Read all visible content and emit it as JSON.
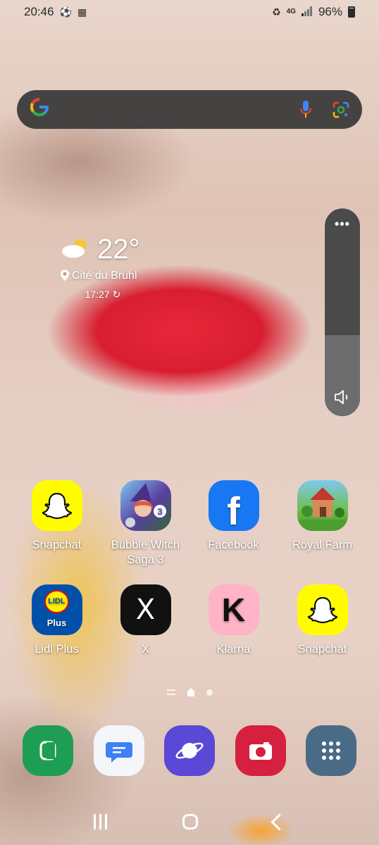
{
  "status_bar": {
    "time": "20:46",
    "network": "4G",
    "battery": "96%"
  },
  "search": {
    "logo": "G"
  },
  "weather": {
    "temperature": "22°",
    "location": "Cité du Bruhl",
    "updated": "17:27"
  },
  "volume": {
    "more_label": "•••",
    "level": 0.47
  },
  "apps": [
    {
      "label": "Snapchat",
      "icon": "snapchat-icon"
    },
    {
      "label": "Bubble Witch Saga 3",
      "icon": "bubble-witch-icon"
    },
    {
      "label": "Facebook",
      "icon": "facebook-icon"
    },
    {
      "label": "Royal Farm",
      "icon": "royal-farm-icon"
    },
    {
      "label": "Lidl Plus",
      "icon": "lidl-plus-icon"
    },
    {
      "label": "X",
      "icon": "x-icon"
    },
    {
      "label": "Klarna",
      "icon": "klarna-icon"
    },
    {
      "label": "Snapchat",
      "icon": "snapchat-icon"
    }
  ],
  "icon_text": {
    "facebook": "f",
    "lidl_top": "LIDL",
    "lidl_bottom": "Plus",
    "x": "X",
    "klarna": "K",
    "bubble_level": "3"
  },
  "dock": [
    "phone-icon",
    "messages-icon",
    "internet-icon",
    "camera-icon",
    "app-drawer-icon"
  ],
  "colors": {
    "snapchat": "#fffc00",
    "facebook": "#1877f2",
    "lidl": "#0050aa",
    "x": "#111111",
    "klarna": "#ffb3c7",
    "phone": "#1e9e55",
    "camera": "#d6203f",
    "internet": "#5a48d6",
    "drawer": "#4a6b86"
  }
}
